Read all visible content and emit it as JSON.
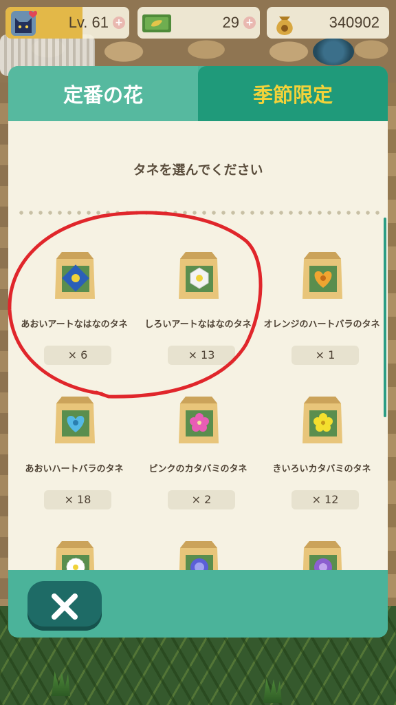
{
  "hud": {
    "level": "Lv. 61",
    "tickets": "29",
    "bells": "340902"
  },
  "tabs": [
    {
      "label": "定番の花",
      "selected": false
    },
    {
      "label": "季節限定",
      "selected": true
    }
  ],
  "prompt": "タネを選んでください",
  "seeds": [
    {
      "name": "あおいアートなはなのタネ",
      "count": "× 6",
      "flower_color": "#2b5fb8",
      "icon": "blue-art-flower-icon"
    },
    {
      "name": "しろいアートなはなのタネ",
      "count": "× 13",
      "flower_color": "#f3f3f3",
      "icon": "white-art-flower-icon"
    },
    {
      "name": "オレンジのハートバラのタネ",
      "count": "× 1",
      "flower_color": "#f0a531",
      "icon": "orange-heart-rose-icon"
    },
    {
      "name": "あおいハートバラのタネ",
      "count": "× 18",
      "flower_color": "#54b9e6",
      "icon": "blue-heart-rose-icon"
    },
    {
      "name": "ピンクのカタバミのタネ",
      "count": "× 2",
      "flower_color": "#e85db5",
      "icon": "pink-oxalis-icon"
    },
    {
      "name": "きいろいカタバミのタネ",
      "count": "× 12",
      "flower_color": "#f4df2e",
      "icon": "yellow-oxalis-icon"
    },
    {
      "name": "",
      "count": "",
      "flower_color": "#ffffff",
      "icon": "white-flower-icon"
    },
    {
      "name": "",
      "count": "",
      "flower_color": "#5b5fd8",
      "icon": "blue-purple-flower-icon"
    },
    {
      "name": "",
      "count": "",
      "flower_color": "#8c5fcf",
      "icon": "purple-flower-icon"
    }
  ],
  "colors": {
    "panel": "#4bb39a",
    "tab_selected": "#1f9a7a",
    "seasonal_text": "#f2d23a",
    "annotation": "#e0262b"
  }
}
